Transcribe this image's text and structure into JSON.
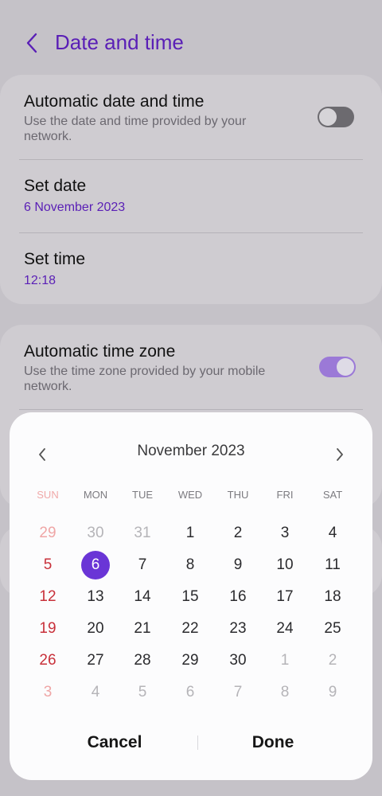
{
  "header": {
    "title": "Date and time"
  },
  "settings": {
    "auto_datetime": {
      "title": "Automatic date and time",
      "subtitle": "Use the date and time provided by your network.",
      "enabled": false
    },
    "set_date": {
      "title": "Set date",
      "value": "6 November 2023"
    },
    "set_time": {
      "title": "Set time",
      "value": "12:18"
    },
    "auto_timezone": {
      "title": "Automatic time zone",
      "subtitle": "Use the time zone provided by your mobile network.",
      "enabled": true
    }
  },
  "picker": {
    "month_label": "November 2023",
    "weekdays": [
      "SUN",
      "MON",
      "TUE",
      "WED",
      "THU",
      "FRI",
      "SAT"
    ],
    "weeks": [
      [
        {
          "d": "29",
          "o": true
        },
        {
          "d": "30",
          "o": true
        },
        {
          "d": "31",
          "o": true
        },
        {
          "d": "1"
        },
        {
          "d": "2"
        },
        {
          "d": "3"
        },
        {
          "d": "4"
        }
      ],
      [
        {
          "d": "5"
        },
        {
          "d": "6",
          "s": true
        },
        {
          "d": "7"
        },
        {
          "d": "8"
        },
        {
          "d": "9"
        },
        {
          "d": "10"
        },
        {
          "d": "11"
        }
      ],
      [
        {
          "d": "12"
        },
        {
          "d": "13"
        },
        {
          "d": "14"
        },
        {
          "d": "15"
        },
        {
          "d": "16"
        },
        {
          "d": "17"
        },
        {
          "d": "18"
        }
      ],
      [
        {
          "d": "19"
        },
        {
          "d": "20"
        },
        {
          "d": "21"
        },
        {
          "d": "22"
        },
        {
          "d": "23"
        },
        {
          "d": "24"
        },
        {
          "d": "25"
        }
      ],
      [
        {
          "d": "26"
        },
        {
          "d": "27"
        },
        {
          "d": "28"
        },
        {
          "d": "29"
        },
        {
          "d": "30"
        },
        {
          "d": "1",
          "o": true
        },
        {
          "d": "2",
          "o": true
        }
      ],
      [
        {
          "d": "3",
          "o": true
        },
        {
          "d": "4",
          "o": true
        },
        {
          "d": "5",
          "o": true
        },
        {
          "d": "6",
          "o": true
        },
        {
          "d": "7",
          "o": true
        },
        {
          "d": "8",
          "o": true
        },
        {
          "d": "9",
          "o": true
        }
      ]
    ],
    "cancel_label": "Cancel",
    "done_label": "Done"
  },
  "colors": {
    "accent": "#6a35d6",
    "title_purple": "#5a1fb6",
    "sunday_red": "#c8303a"
  }
}
